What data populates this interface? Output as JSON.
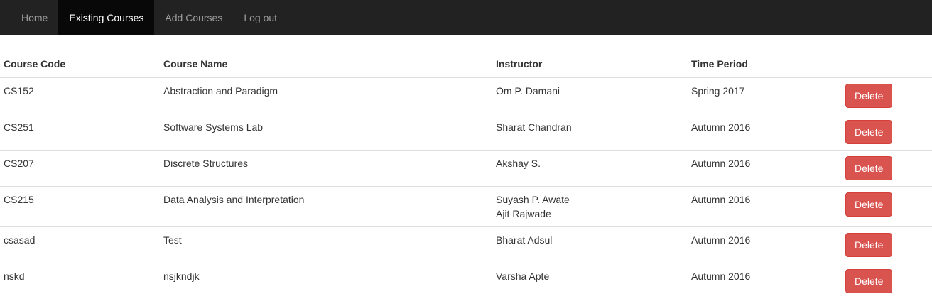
{
  "nav": {
    "items": [
      {
        "label": "Home",
        "active": false
      },
      {
        "label": "Existing Courses",
        "active": true
      },
      {
        "label": "Add Courses",
        "active": false
      },
      {
        "label": "Log out",
        "active": false
      }
    ]
  },
  "table": {
    "headers": {
      "code": "Course Code",
      "name": "Course Name",
      "instructor": "Instructor",
      "time": "Time Period"
    },
    "delete_label": "Delete",
    "rows": [
      {
        "code": "CS152",
        "name": "Abstraction and Paradigm",
        "instructors": [
          "Om P. Damani"
        ],
        "time": "Spring 2017"
      },
      {
        "code": "CS251",
        "name": "Software Systems Lab",
        "instructors": [
          "Sharat Chandran"
        ],
        "time": "Autumn 2016"
      },
      {
        "code": "CS207",
        "name": "Discrete Structures",
        "instructors": [
          "Akshay S."
        ],
        "time": "Autumn 2016"
      },
      {
        "code": "CS215",
        "name": "Data Analysis and Interpretation",
        "instructors": [
          "Suyash P. Awate",
          "Ajit Rajwade"
        ],
        "time": "Autumn 2016"
      },
      {
        "code": "csasad",
        "name": "Test",
        "instructors": [
          "Bharat Adsul"
        ],
        "time": "Autumn 2016"
      },
      {
        "code": "nskd",
        "name": "nsjkndjk",
        "instructors": [
          "Varsha Apte"
        ],
        "time": "Autumn 2016"
      }
    ]
  },
  "colors": {
    "navbar_bg": "#222222",
    "navbar_active_bg": "#080808",
    "nav_text": "#9d9d9d",
    "danger": "#d9534f"
  }
}
